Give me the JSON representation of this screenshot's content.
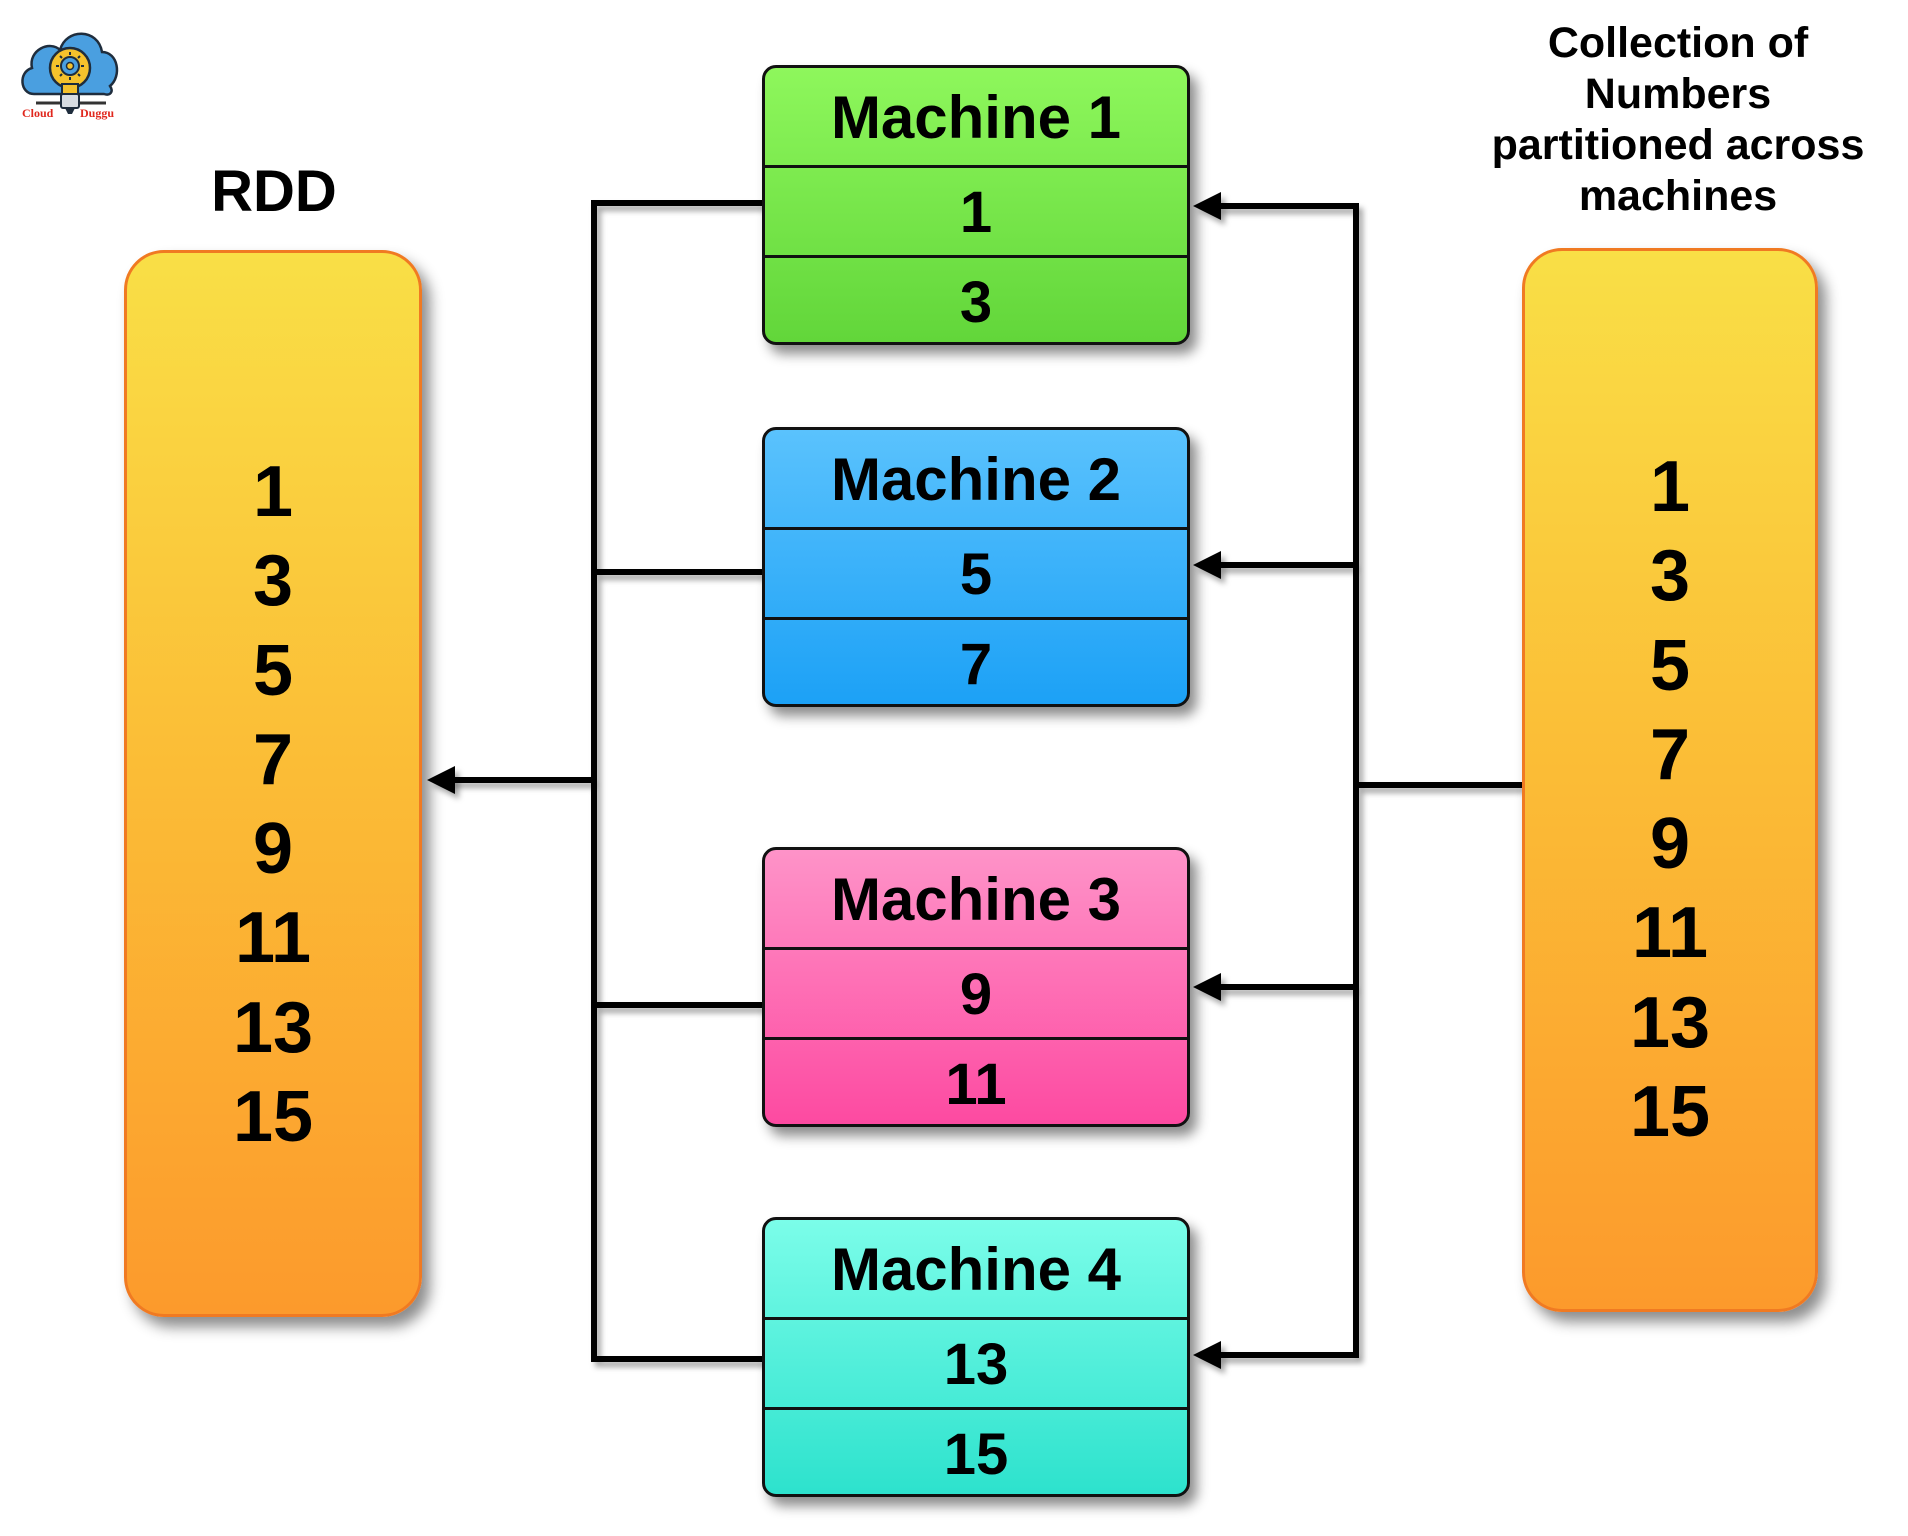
{
  "logo": {
    "icon": "cloud-lightbulb-icon",
    "text_left": "Cloud",
    "text_right": "Duggu",
    "colors": {
      "cloud": "#4a9fe0",
      "bulb": "#f6c22c",
      "text": "#e0281e"
    }
  },
  "rdd": {
    "title": "RDD",
    "values": [
      "1",
      "3",
      "5",
      "7",
      "9",
      "11",
      "13",
      "15"
    ]
  },
  "collection": {
    "title_lines": [
      "Collection of",
      "Numbers",
      "partitioned across",
      "machines"
    ],
    "values": [
      "1",
      "3",
      "5",
      "7",
      "9",
      "11",
      "13",
      "15"
    ]
  },
  "machines": [
    {
      "name": "Machine 1",
      "values": [
        "1",
        "3"
      ],
      "color": "#7be84c"
    },
    {
      "name": "Machine 2",
      "values": [
        "5",
        "7"
      ],
      "color": "#3bb2fa"
    },
    {
      "name": "Machine 3",
      "values": [
        "9",
        "11"
      ],
      "color": "#fd6eb4"
    },
    {
      "name": "Machine 4",
      "values": [
        "13",
        "15"
      ],
      "color": "#52efdb"
    }
  ],
  "colors": {
    "column_top": "#f9df46",
    "column_bottom": "#fc9a2c",
    "column_border": "#f07a22",
    "connector": "#000000"
  }
}
